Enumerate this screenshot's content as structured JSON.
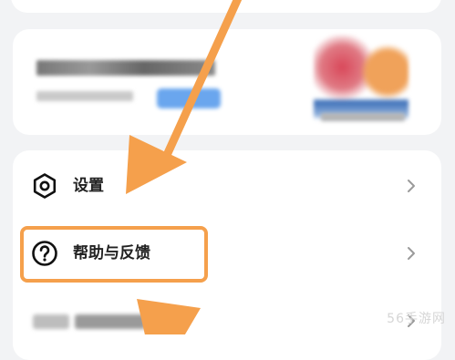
{
  "menu": {
    "items": [
      {
        "label": "设置",
        "icon": "gear-icon"
      },
      {
        "label": "帮助与反馈",
        "icon": "help-icon"
      }
    ]
  },
  "watermark": "56手游网",
  "colors": {
    "highlight": "#f5a04c",
    "arrow": "#f5a04c",
    "page_background": "#f2f3f5",
    "card": "#ffffff"
  }
}
